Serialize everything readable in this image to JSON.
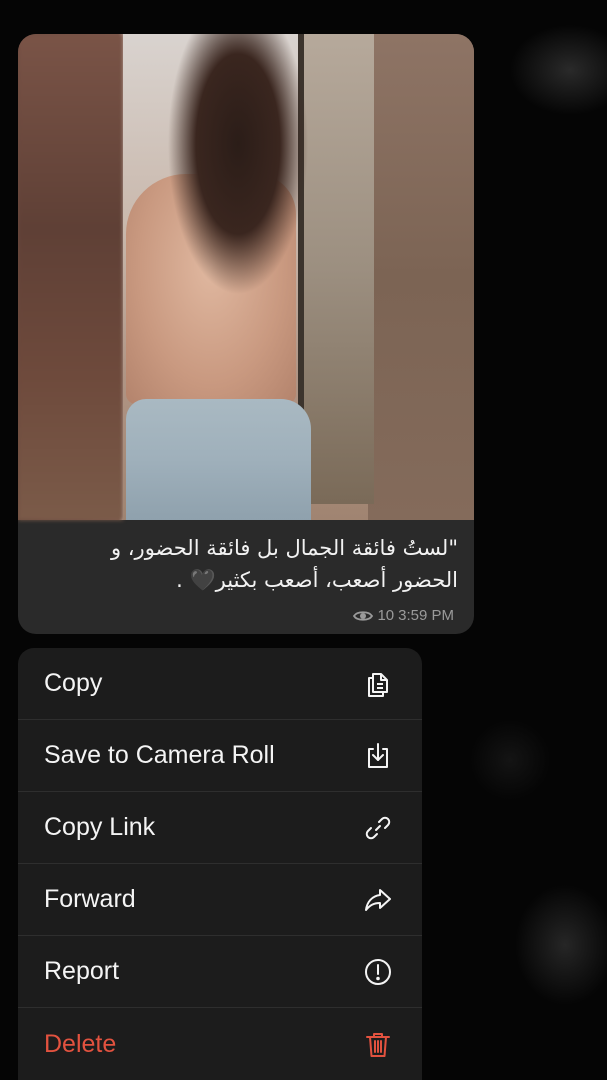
{
  "message": {
    "caption_lines": [
      "\"لستُ فائقة الجمال بل فائقة الحضور، و",
      "الحضور أصعب، أصعب بكثير🖤 ."
    ],
    "views": "10",
    "time": "3:59 PM"
  },
  "context_menu": {
    "items": [
      {
        "label": "Copy",
        "icon": "copy-icon"
      },
      {
        "label": "Save to Camera Roll",
        "icon": "save-icon"
      },
      {
        "label": "Copy Link",
        "icon": "link-icon"
      },
      {
        "label": "Forward",
        "icon": "forward-icon"
      },
      {
        "label": "Report",
        "icon": "report-icon"
      },
      {
        "label": "Delete",
        "icon": "trash-icon",
        "color": "#e2523f"
      }
    ]
  },
  "colors": {
    "background": "#050505",
    "bubble": "#2a2a2a",
    "menu": "#1c1c1c",
    "danger": "#e2523f"
  }
}
